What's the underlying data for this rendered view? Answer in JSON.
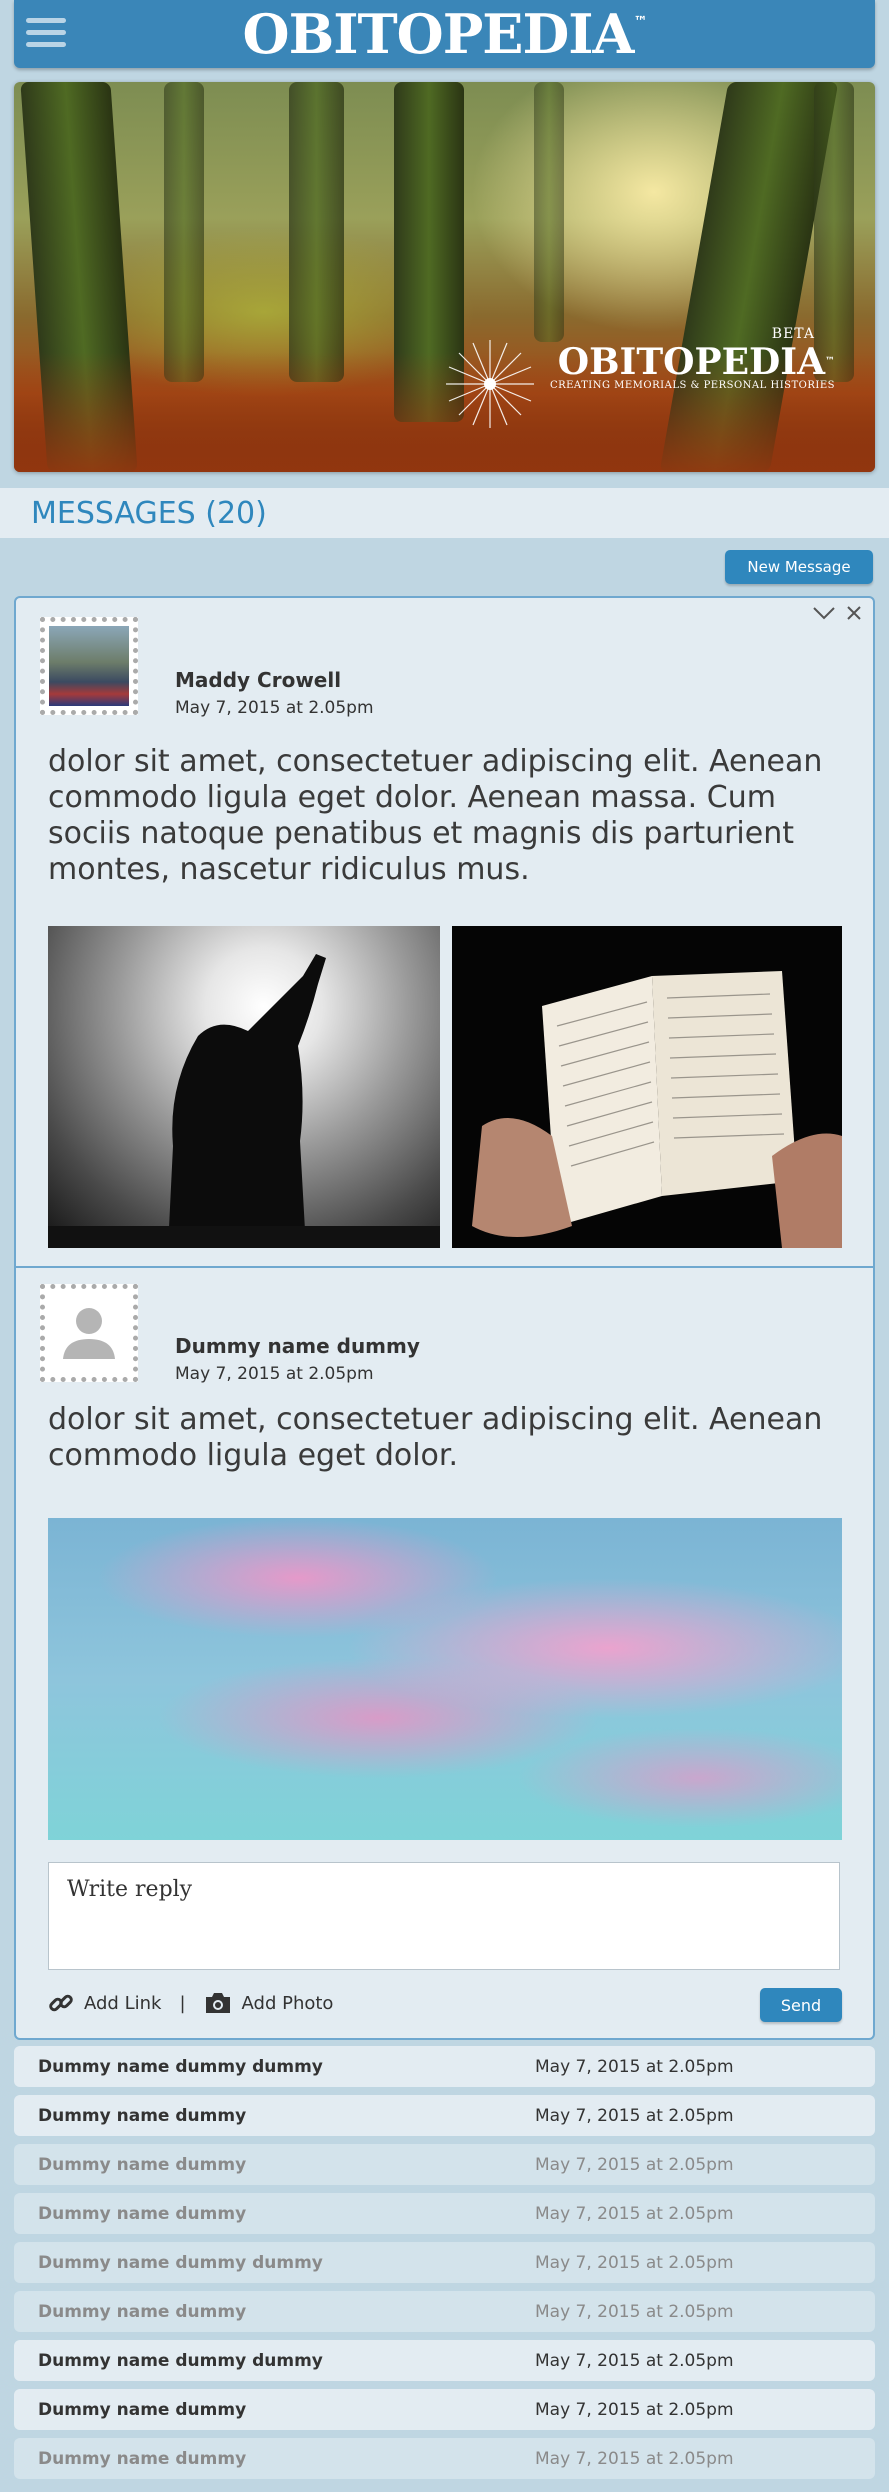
{
  "header": {
    "title": "OBITOPEDIA",
    "trademark": "™",
    "menu_icon": "hamburger-menu-icon"
  },
  "hero": {
    "logo_name": "OBITOPEDIA",
    "logo_trademark": "™",
    "logo_badge": "BETA",
    "logo_tagline": "CREATING MEMORIALS & PERSONAL HISTORIES"
  },
  "messages": {
    "heading": "MESSAGES (20)",
    "new_button": "New Message"
  },
  "thread": {
    "collapse_icon": "chevron-down-icon",
    "close_icon": "close-icon",
    "items": [
      {
        "author": "Maddy Crowell",
        "date": "May 7, 2015 at 2.05pm",
        "text": "dolor sit amet, consectetuer adipiscing elit. Aenean commodo ligula eget dolor. Aenean massa. Cum sociis natoque penatibus et magnis dis parturient montes, nascetur ridiculus mus."
      },
      {
        "author": "Dummy name dummy",
        "date": "May 7, 2015 at 2.05pm",
        "text": "dolor sit amet, consectetuer adipiscing elit. Aenean commodo ligula eget dolor."
      }
    ],
    "reply": {
      "placeholder": "Write reply",
      "add_link": "Add Link",
      "separator": "|",
      "add_photo": "Add Photo",
      "send": "Send"
    }
  },
  "list": [
    {
      "name": "Dummy name dummy dummy",
      "date": "May 7, 2015 at 2.05pm",
      "state": "read"
    },
    {
      "name": "Dummy name dummy",
      "date": "May 7, 2015 at 2.05pm",
      "state": "read"
    },
    {
      "name": "Dummy name dummy",
      "date": "May 7, 2015 at 2.05pm",
      "state": "unread"
    },
    {
      "name": "Dummy name dummy",
      "date": "May 7, 2015 at 2.05pm",
      "state": "unread"
    },
    {
      "name": "Dummy name dummy dummy",
      "date": "May 7, 2015 at 2.05pm",
      "state": "unread"
    },
    {
      "name": "Dummy name dummy",
      "date": "May 7, 2015 at 2.05pm",
      "state": "unread"
    },
    {
      "name": "Dummy name dummy dummy",
      "date": "May 7, 2015 at 2.05pm",
      "state": "read"
    },
    {
      "name": "Dummy name dummy",
      "date": "May 7, 2015 at 2.05pm",
      "state": "read"
    },
    {
      "name": "Dummy name dummy",
      "date": "May 7, 2015 at 2.05pm",
      "state": "unread"
    }
  ],
  "colors": {
    "accent": "#2f87bd",
    "header_bg": "#3a86b8",
    "page_bg": "#bfd6e2",
    "card_bg": "#e3ecf2"
  }
}
